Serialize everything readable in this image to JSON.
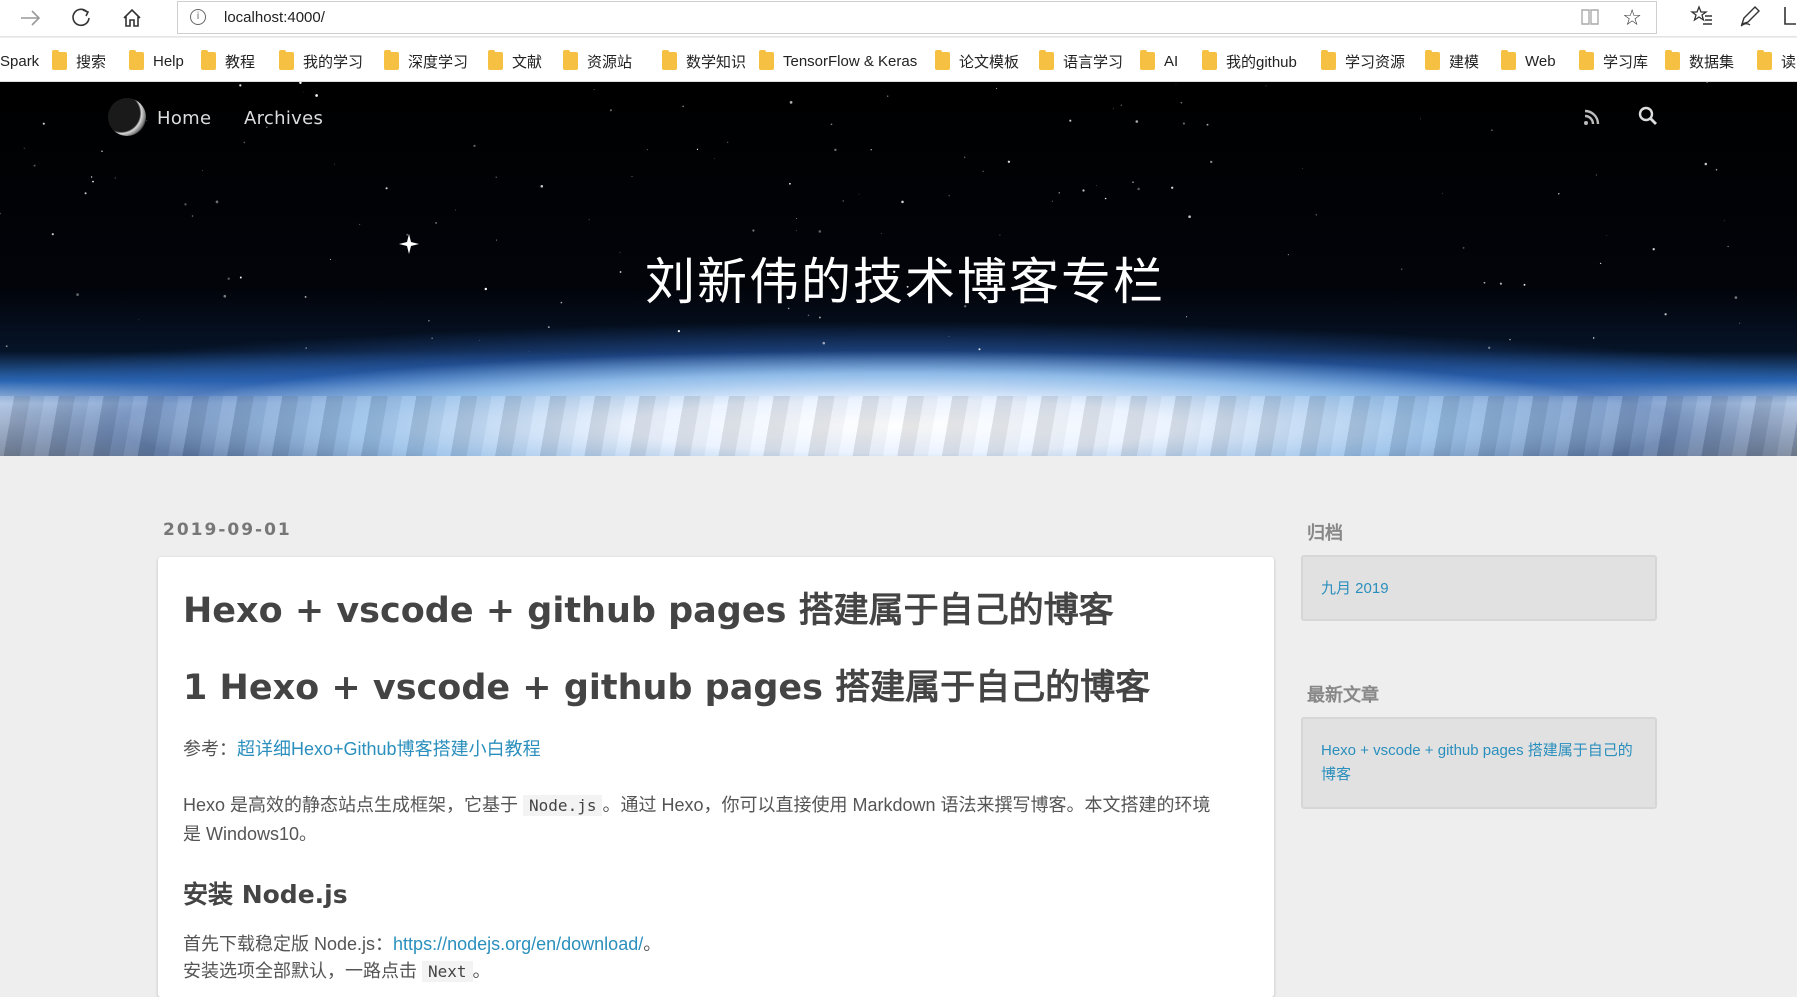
{
  "browser": {
    "url": "localhost:4000/",
    "icons": [
      "forward-icon",
      "refresh-icon",
      "home-icon",
      "info-icon",
      "reading-view-icon",
      "favorite-star-icon",
      "favorites-list-icon",
      "pen-icon",
      "share-icon"
    ]
  },
  "bookmarks": [
    {
      "label": "Spark",
      "folder": false
    },
    {
      "label": "搜索",
      "folder": true
    },
    {
      "label": "Help",
      "folder": true
    },
    {
      "label": "教程",
      "folder": true
    },
    {
      "label": "我的学习",
      "folder": true
    },
    {
      "label": "深度学习",
      "folder": true
    },
    {
      "label": "文献",
      "folder": true
    },
    {
      "label": "资源站",
      "folder": true
    },
    {
      "label": "数学知识",
      "folder": true
    },
    {
      "label": "TensorFlow & Keras",
      "folder": true
    },
    {
      "label": "论文模板",
      "folder": true
    },
    {
      "label": "语言学习",
      "folder": true
    },
    {
      "label": "AI",
      "folder": true
    },
    {
      "label": "我的github",
      "folder": true
    },
    {
      "label": "学习资源",
      "folder": true
    },
    {
      "label": "建模",
      "folder": true
    },
    {
      "label": "Web",
      "folder": true
    },
    {
      "label": "学习库",
      "folder": true
    },
    {
      "label": "数据集",
      "folder": true
    },
    {
      "label": "读",
      "folder": true
    }
  ],
  "nav": {
    "home": "Home",
    "archives": "Archives"
  },
  "site_title": "刘新伟的技术博客专栏",
  "post": {
    "date": "2019-09-01",
    "title": "Hexo + vscode + github pages 搭建属于自己的博客",
    "heading1": "1 Hexo + vscode + github pages 搭建属于自己的博客",
    "ref_prefix": "参考：",
    "ref_link": "超详细Hexo+Github博客搭建小白教程",
    "intro_a": "Hexo 是高效的静态站点生成框架，它基于 ",
    "intro_code": "Node.js",
    "intro_b": "。通过 Hexo，你可以直接使用 Markdown 语法来撰写博客。本文搭建的环境是 Windows10。",
    "h2": "安装 Node.js",
    "dl_prefix": "首先下载稳定版 Node.js：",
    "dl_link": "https://nodejs.org/en/download/",
    "dl_suffix": "。",
    "install_prefix": "安装选项全部默认，一路点击 ",
    "install_code": "Next",
    "install_suffix": "。"
  },
  "sidebar": {
    "archive_title": "归档",
    "archive_item": "九月 2019",
    "recent_title": "最新文章",
    "recent_item": "Hexo + vscode + github pages 搭建属于自己的博客"
  },
  "colors": {
    "link": "#2a8fbd",
    "folder": "#f6c142",
    "page_bg": "#eeeeee"
  }
}
